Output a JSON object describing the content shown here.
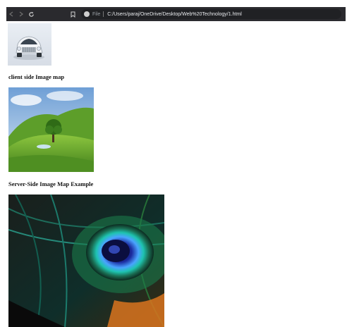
{
  "browser": {
    "file_label": "File",
    "url": "C:/Users/paraj/OneDrive/Desktop/Web%20Technology/1.html"
  },
  "page": {
    "heading_client": "client side Image map",
    "heading_server": "Server-Side Image Map Example"
  },
  "colors": {
    "toolbar_bg": "#2a2a2e",
    "address_bg": "#202124",
    "page_bg": "#ffffff"
  },
  "icons": [
    "back-arrow-icon",
    "forward-arrow-icon",
    "reload-icon",
    "bookmark-icon",
    "info-icon"
  ]
}
